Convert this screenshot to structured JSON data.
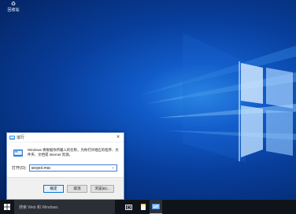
{
  "desktop": {
    "icons": [
      {
        "label": "回收站",
        "icon": "recycle-bin-icon"
      }
    ]
  },
  "run_dialog": {
    "title": "运行",
    "close_glyph": "×",
    "description": "Windows 将根据你所输入的名称，为你打开相应的程序、文件夹、文档或 Internet 资源。",
    "open_label": "打开(O):",
    "input_value": "secpol.msc",
    "dropdown_glyph": "⌄",
    "buttons": {
      "ok": "确定",
      "cancel": "取消",
      "browse": "浏览(B)..."
    }
  },
  "taskbar": {
    "search_placeholder": "搜索 Web 和 Windows",
    "icons": [
      "windows-start-icon",
      "task-view-icon",
      "file-explorer-icon",
      "edge-icon"
    ]
  },
  "colors": {
    "wallpaper_core": "#2f8ee8",
    "wallpaper_dark": "#04225f",
    "taskbar": "#0f131a",
    "accent": "#0a74d8"
  }
}
